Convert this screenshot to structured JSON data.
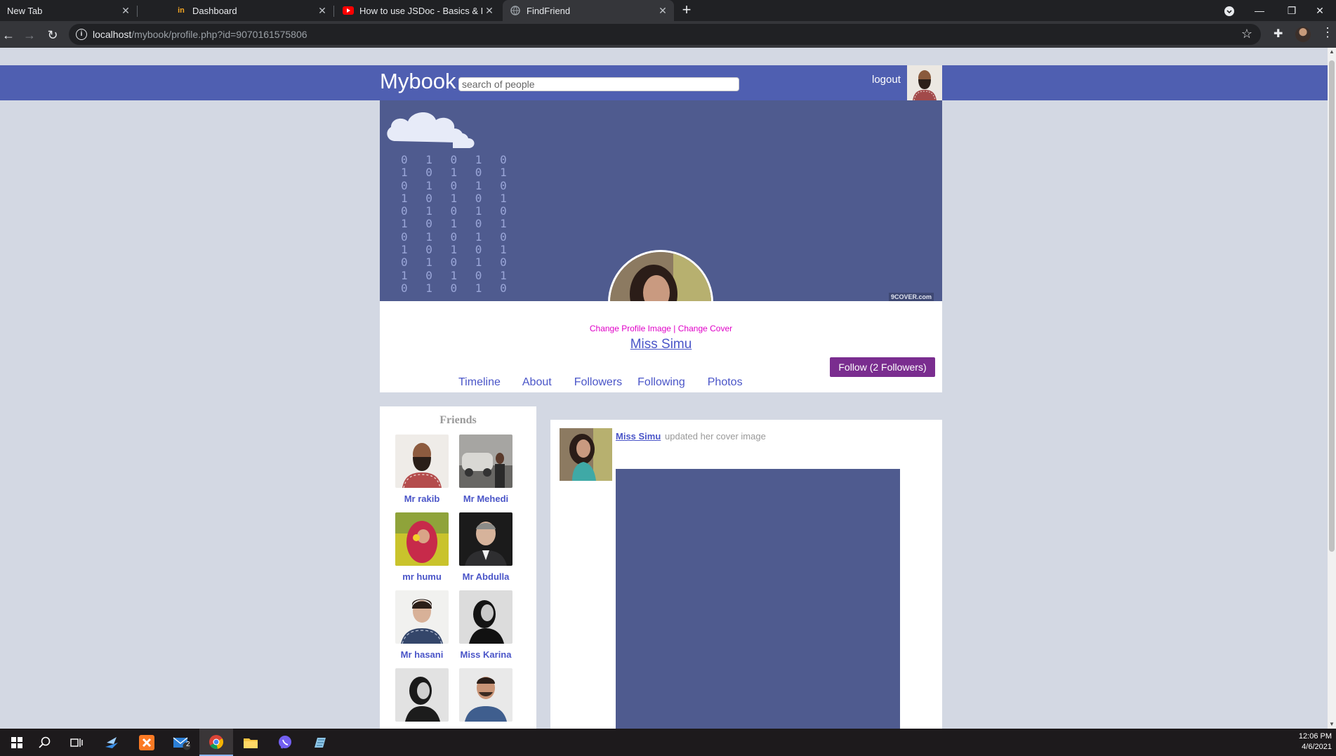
{
  "browser": {
    "tabs": [
      {
        "title": "New Tab",
        "favicon": "none"
      },
      {
        "title": "Dashboard",
        "favicon": "in-logo-icon"
      },
      {
        "title": "How to use JSDoc - Basics & Intr",
        "favicon": "youtube-icon"
      },
      {
        "title": "FindFriend",
        "favicon": "globe-icon"
      }
    ],
    "active_tab": 3,
    "url_host": "localhost",
    "url_path": "/mybook/profile.php?id=9070161575806"
  },
  "site": {
    "logo": "Mybook",
    "search_placeholder": "search of people",
    "logout_label": "logout"
  },
  "profile": {
    "cover_watermark": "9COVER.com",
    "cover_bits": "0 1 0 1 0\n1 0 1 0 1\n0 1 0 1 0\n1 0 1 0 1\n0 1 0 1 0\n1 0 1 0 1\n0 1 0 1 0\n1 0 1 0 1\n0 1 0 1 0\n1 0 1 0 1\n0 1 0 1 0",
    "change_profile_label": "Change Profile Image",
    "separator": "|",
    "change_cover_label": "Change Cover",
    "name": "Miss Simu",
    "follow_label": "Follow (2 Followers)",
    "menu": [
      "Timeline",
      "About",
      "Followers",
      "Following",
      "Photos"
    ]
  },
  "friends": {
    "title": "Friends",
    "list": [
      {
        "name": "Mr rakib"
      },
      {
        "name": "Mr Mehedi"
      },
      {
        "name": "mr humu"
      },
      {
        "name": "Mr Abdulla"
      },
      {
        "name": "Mr hasani"
      },
      {
        "name": "Miss Karina"
      },
      {
        "name": ""
      },
      {
        "name": ""
      }
    ]
  },
  "post": {
    "author": "Miss Simu",
    "action": "updated her cover image"
  },
  "taskbar": {
    "time": "12:06 PM",
    "date": "4/6/2021",
    "mail_badge": "2"
  },
  "colors": {
    "header": "#4f5fb1",
    "cover": "#4f5b8f",
    "link": "#4a55c8",
    "follow_button": "#7a2d8f",
    "change_links": "#e000c8"
  }
}
